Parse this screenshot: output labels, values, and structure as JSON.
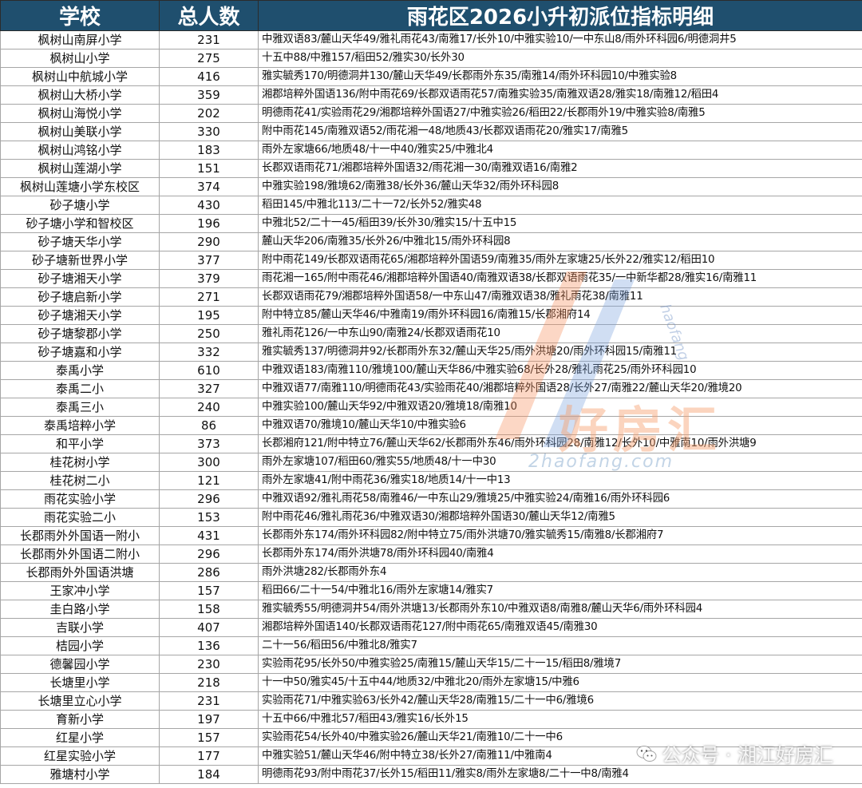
{
  "header": {
    "school": "学校",
    "total": "总人数",
    "title": "雨花区2026小升初派位指标明细"
  },
  "rows": [
    {
      "school": "枫树山南屏小学",
      "total": "231",
      "detail": "中雅双语83/麓山天华49/雅礼雨花43/南雅17/长外10/中雅实验10/一中东山8/雨外环科园6/明德洞井5"
    },
    {
      "school": "枫树山小学",
      "total": "275",
      "detail": "十五中88/中雅157/稻田52/雅实30/长外30"
    },
    {
      "school": "枫树山中航城小学",
      "total": "416",
      "detail": "雅实毓秀170/明德洞井130/麓山天华49/长郡雨外东35/南雅14/雨外环科园10/中雅实验8"
    },
    {
      "school": "枫树山大桥小学",
      "total": "359",
      "detail": "湘郡培粹外国语136/附中雨花69/长郡双语雨花57/南雅实验35/南雅双语28/雅实18/南雅12/稻田4"
    },
    {
      "school": "枫树山海悦小学",
      "total": "202",
      "detail": "明德雨花41/实验雨花29/湘郡培粹外国语27/中雅实验26/稻田22/长郡雨外19/中雅实验8/南雅5"
    },
    {
      "school": "枫树山美联小学",
      "total": "330",
      "detail": "附中雨花145/南雅双语52/雨花湘一48/地质43/长郡双语雨花20/雅实17/南雅5"
    },
    {
      "school": "枫树山鸿铭小学",
      "total": "183",
      "detail": "雨外左家塘66/地质48/十一中40/雅实25/中雅北4"
    },
    {
      "school": "枫树山莲湖小学",
      "total": "151",
      "detail": "长郡双语雨花71/湘郡培粹外国语32/雨花湘一30/南雅双语16/南雅2"
    },
    {
      "school": "枫树山莲塘小学东校区",
      "total": "374",
      "detail": "中雅实验198/雅境62/南雅38/长外36/麓山天华32/雨外环科园8"
    },
    {
      "school": "砂子塘小学",
      "total": "430",
      "detail": "稻田145/中雅北113/二十一72/长外52/雅实48"
    },
    {
      "school": "砂子塘小学和智校区",
      "total": "196",
      "detail": "中雅北52/二十一45/稻田39/长外30/雅实15/十五中15"
    },
    {
      "school": "砂子塘天华小学",
      "total": "290",
      "detail": "麓山天华206/南雅35/长外26/中雅北15/雨外环科园8"
    },
    {
      "school": "砂子塘新世界小学",
      "total": "377",
      "detail": "附中雨花149/长郡双语雨花65/湘郡培粹外国语59/南雅35/雨外左家塘25/长外22/雅实12/稻田10"
    },
    {
      "school": "砂子塘湘天小学",
      "total": "379",
      "detail": "雨花湘一165/附中雨花46/湘郡培粹外国语40/南雅双语38/长郡双语雨花35/一中新华都28/雅实16/南雅11"
    },
    {
      "school": "砂子塘启新小学",
      "total": "271",
      "detail": "长郡双语雨花79/湘郡培粹外国语58/一中东山47/南雅双语38/雅礼雨花38/南雅11"
    },
    {
      "school": "砂子塘湘天小学",
      "total": "195",
      "detail": "附中特立85/麓山天华46/中雅南19/雨外环科园16/南雅15/长郡湘府14"
    },
    {
      "school": "砂子塘黎郡小学",
      "total": "250",
      "detail": "雅礼雨花126/一中东山90/南雅24/长郡双语雨花10"
    },
    {
      "school": "砂子塘嘉和小学",
      "total": "332",
      "detail": "雅实毓秀137/明德洞井92/长郡雨外东32/麓山天华25/雨外洪塘20/雨外环科园15/南雅11"
    },
    {
      "school": "泰禹小学",
      "total": "610",
      "detail": "中雅双语183/南雅110/雅境100/麓山天华86/中雅实验68/长外28/雅礼雨花25/雨外环科园10"
    },
    {
      "school": "泰禹二小",
      "total": "327",
      "detail": "中雅双语77/南雅110/明德雨花43/实验雨花40/湘郡培粹外国语28/长外27/南雅22/麓山天华20/雅境20"
    },
    {
      "school": "泰禹三小",
      "total": "240",
      "detail": "中雅实验100/麓山天华92/中雅双语20/雅境18/南雅10"
    },
    {
      "school": "泰禹培粹小学",
      "total": "86",
      "detail": "中雅双语70/雅境10/麓山天华10/中雅实验6"
    },
    {
      "school": "和平小学",
      "total": "373",
      "detail": "长郡湘府121/附中特立76/麓山天华62/长郡雨外东46/雨外环科园28/南雅12/长外10/中雅南10/雨外洪塘9"
    },
    {
      "school": "桂花树小学",
      "total": "300",
      "detail": "雨外左家塘107/稻田60/雅实55/地质48/十一中30"
    },
    {
      "school": "桂花树二小",
      "total": "121",
      "detail": "雨外左家塘41/附中雨花36/雅实18/地质14/十一中13"
    },
    {
      "school": "雨花实验小学",
      "total": "296",
      "detail": "中雅双语92/雅礼雨花58/南雅46/一中东山29/雅境25/中雅实验24/南雅16/雨外环科园6"
    },
    {
      "school": "雨花实验二小",
      "total": "153",
      "detail": "附中雨花46/雅礼雨花36/中雅双语30/湘郡培粹外国语30/麓山天华12/南雅5"
    },
    {
      "school": "长郡雨外外国语一附小",
      "total": "431",
      "detail": "长郡雨外东174/雨外环科园82/附中特立75/雨外洪塘70/雅实毓秀15/南雅8/长郡湘府7"
    },
    {
      "school": "长郡雨外外国语二附小",
      "total": "296",
      "detail": "长郡雨外东174/雨外洪塘78/雨外环科园40/南雅4"
    },
    {
      "school": "长郡雨外外国语洪塘",
      "total": "286",
      "detail": "雨外洪塘282/长郡雨外东4"
    },
    {
      "school": "王家冲小学",
      "total": "157",
      "detail": "稻田66/二十一54/中雅北16/雨外左家塘14/雅实7"
    },
    {
      "school": "圭白路小学",
      "total": "158",
      "detail": "雅实毓秀55/明德洞井54/雨外洪塘13/长郡雨外东10/中雅双语8/南雅8/麓山天华6/雨外环科园4"
    },
    {
      "school": "吉联小学",
      "total": "407",
      "detail": "湘郡培粹外国语140/长郡双语雨花127/附中雨花65/南雅双语45/南雅30"
    },
    {
      "school": "桔园小学",
      "total": "136",
      "detail": "二十一56/稻田56/中雅北8/雅实7"
    },
    {
      "school": "德馨园小学",
      "total": "230",
      "detail": "实验雨花95/长外50/中雅实验25/南雅15/麓山天华15/二十一15/稻田8/雅境7"
    },
    {
      "school": "长塘里小学",
      "total": "218",
      "detail": "十一中50/雅实45/十五中44/地质32/中雅北20/雨外左家塘15/中雅6"
    },
    {
      "school": "长塘里立心小学",
      "total": "231",
      "detail": "实验雨花71/中雅实验63/长外42/麓山天华28/南雅15/二十一中6/雅境6"
    },
    {
      "school": "育新小学",
      "total": "197",
      "detail": "十五中66/中雅北57/稻田43/雅实16/长外15"
    },
    {
      "school": "红星小学",
      "total": "157",
      "detail": "实验雨花54/长外40/中雅实验26/麓山天华21/南雅10/二十一中6"
    },
    {
      "school": "红星实验小学",
      "total": "177",
      "detail": "中雅实验51/麓山天华46/附中特立38/长外27/南雅11/中雅南4"
    },
    {
      "school": "雅塘村小学",
      "total": "184",
      "detail": "明德雨花93/附中雨花37/长外15/稻田11/雅实8/雨外左家塘8/二十一中8/南雅4"
    }
  ],
  "watermark": {
    "brand": "好房汇",
    "url": "2haofang.com",
    "vertical": "haofang",
    "footer": "公众号 · 湘江好房汇",
    "icon": "wechat-icon"
  },
  "colors": {
    "header_bg": "#1f4f6e",
    "header_text": "#ffffff"
  }
}
